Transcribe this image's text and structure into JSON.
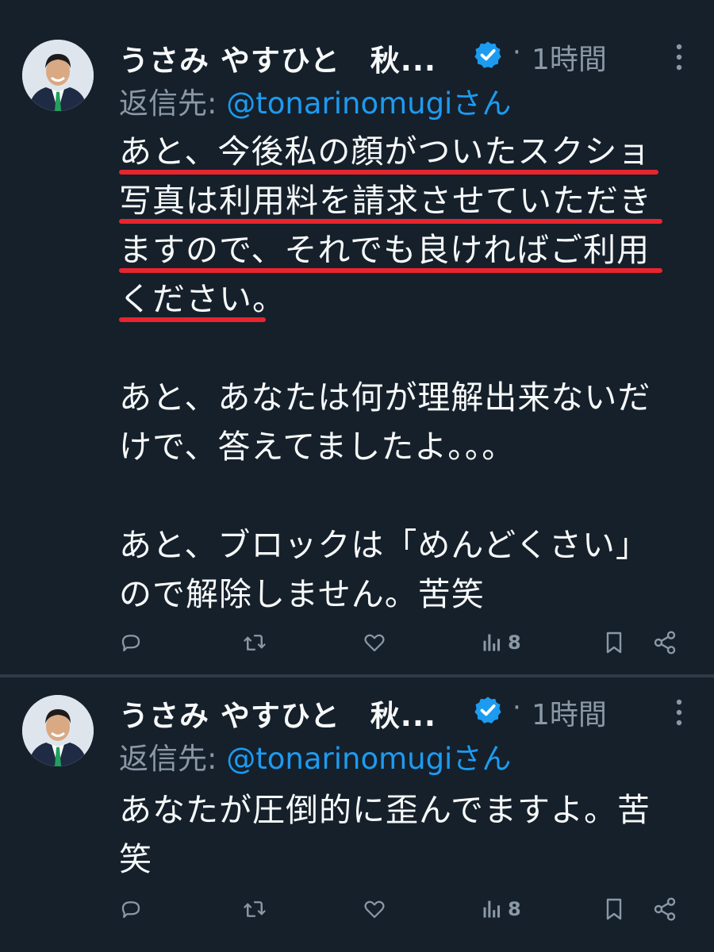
{
  "tweets": [
    {
      "author": "うさみ やすひと　秋...",
      "time": "1時間",
      "dot": "·",
      "reply_prefix": "返信先: ",
      "reply_handle": "@tonarinomugi",
      "reply_suffix": "さん",
      "lines": [
        "あと、今後私の顔がついたスクショ",
        "写真は利用料を請求させていただき",
        "ますので、それでも良ければご利用",
        "ください。",
        "",
        "あと、あなたは何が理解出来ないだ",
        "けで、答えてましたよ。。。",
        "",
        "あと、ブロックは「めんどくさい」",
        "ので解除しません。苦笑"
      ],
      "views": "8"
    },
    {
      "author": "うさみ やすひと　秋...",
      "time": "1時間",
      "dot": "·",
      "reply_prefix": "返信先: ",
      "reply_handle": "@tonarinomugi",
      "reply_suffix": "さん",
      "lines": [
        "あなたが圧倒的に歪んでますよ。苦",
        "笑"
      ],
      "views": "8"
    }
  ],
  "colors": {
    "background": "#15202b",
    "text": "#f7f9f9",
    "secondary": "#8b98a5",
    "link": "#1d9bf0",
    "verified": "#1d9bf0",
    "annotation": "#e8252e"
  },
  "icons": [
    "reply-icon",
    "retweet-icon",
    "like-icon",
    "views-icon",
    "bookmark-icon",
    "share-icon",
    "verified-badge-icon",
    "more-options-icon"
  ]
}
